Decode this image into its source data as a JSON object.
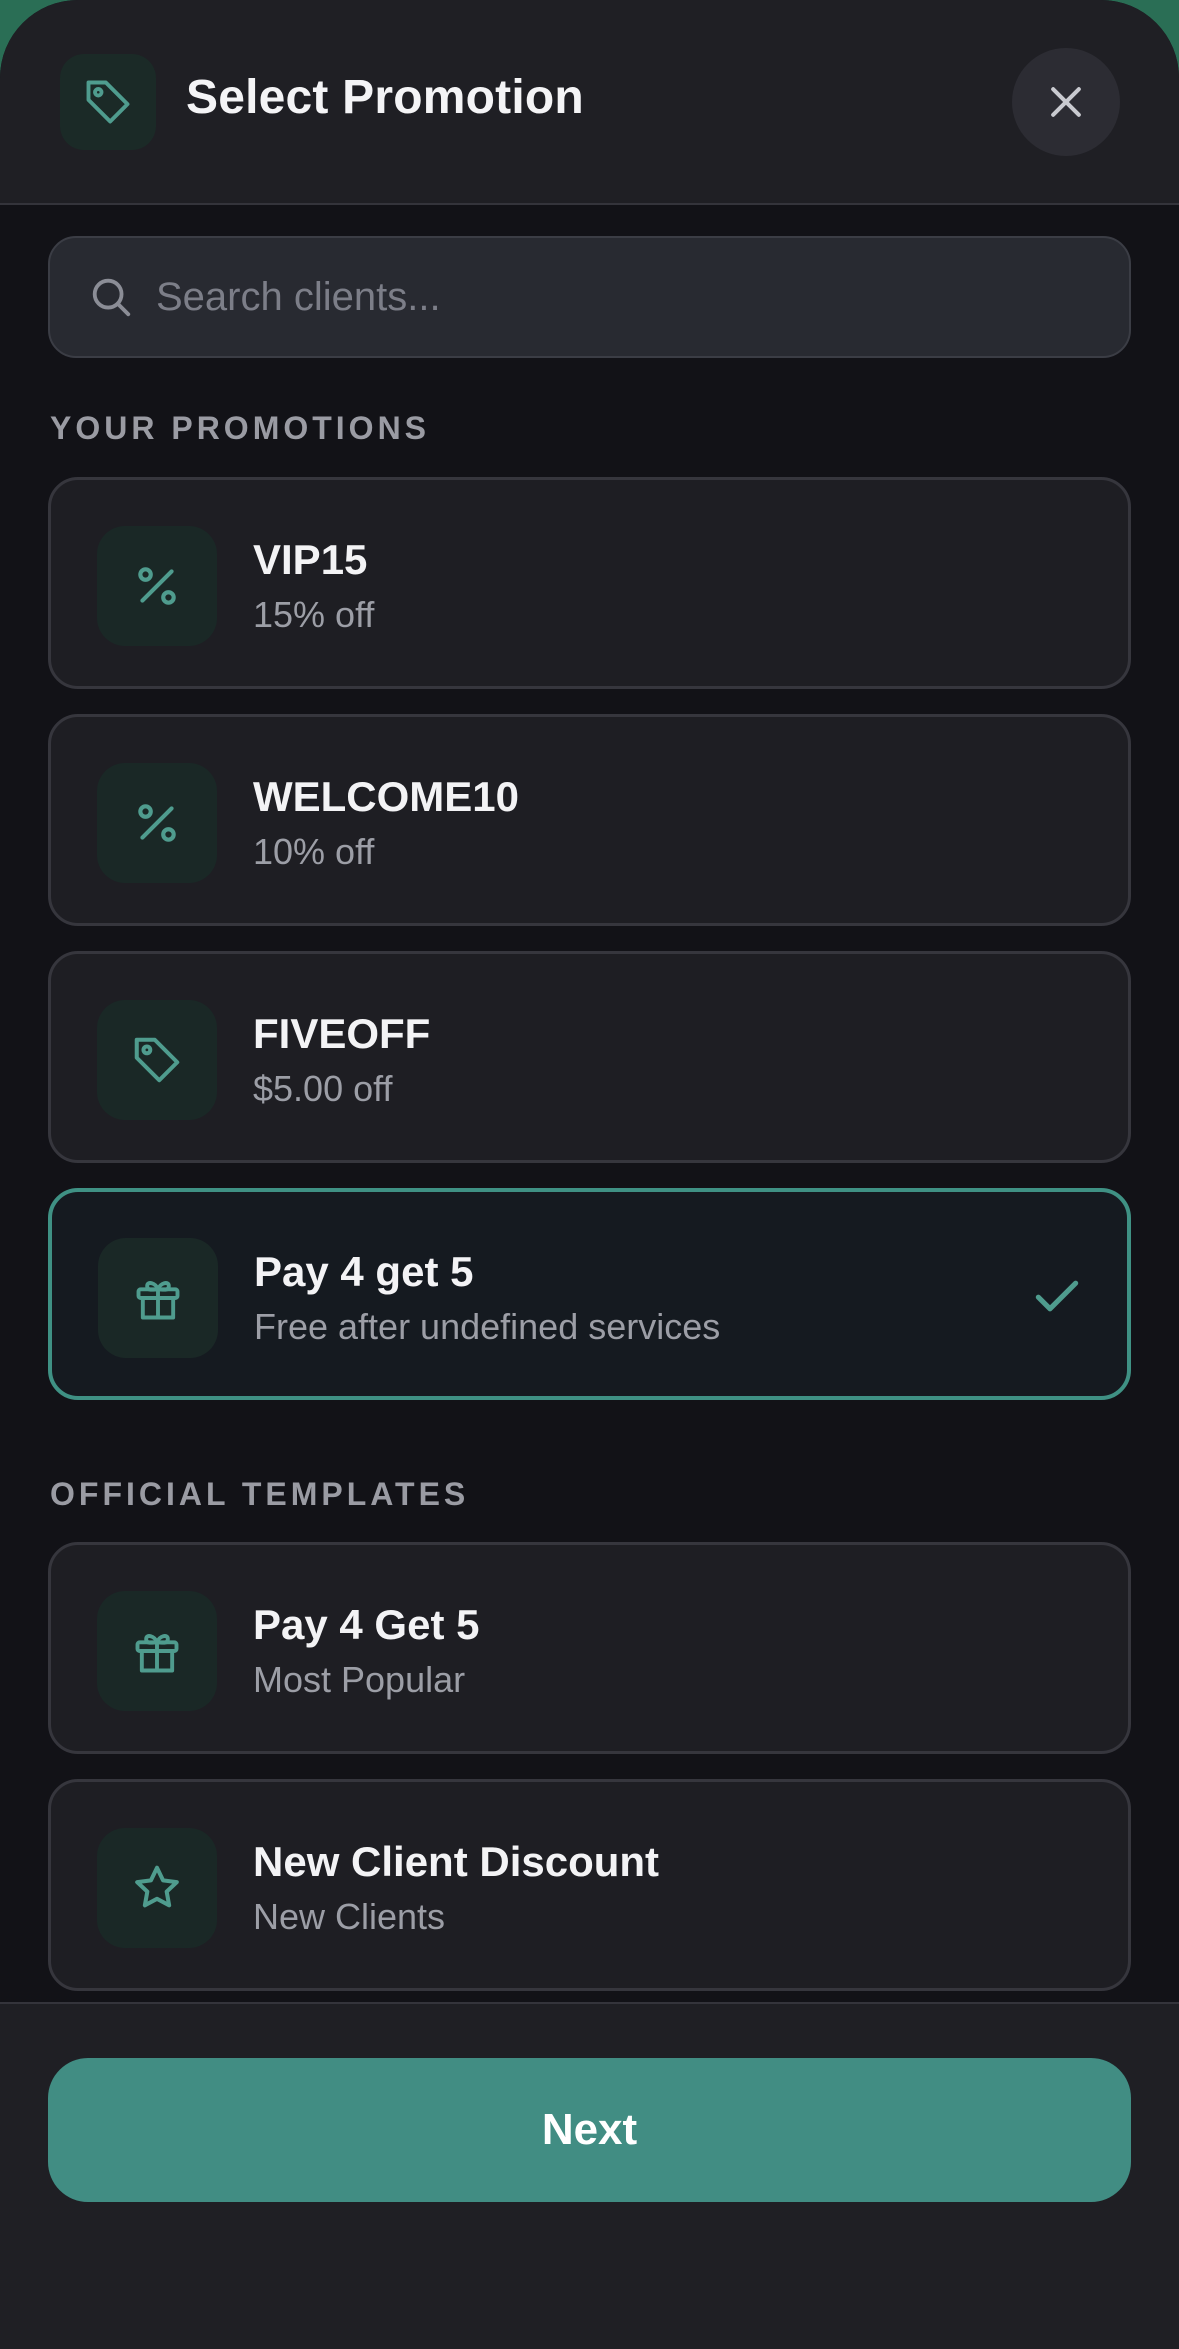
{
  "header": {
    "title": "Select Promotion",
    "icon": "tag-icon",
    "close_icon": "close-icon"
  },
  "search": {
    "placeholder": "Search clients...",
    "value": "",
    "icon": "search-icon"
  },
  "sections": {
    "your_promotions": {
      "label": "YOUR PROMOTIONS",
      "items": [
        {
          "title": "VIP15",
          "subtitle": "15% off",
          "icon": "percent-icon",
          "selected": false
        },
        {
          "title": "WELCOME10",
          "subtitle": "10% off",
          "icon": "percent-icon",
          "selected": false
        },
        {
          "title": "FIVEOFF",
          "subtitle": "$5.00 off",
          "icon": "tag-icon",
          "selected": false
        },
        {
          "title": "Pay 4 get 5",
          "subtitle": "Free after undefined services",
          "icon": "gift-icon",
          "selected": true
        }
      ]
    },
    "official_templates": {
      "label": "OFFICIAL TEMPLATES",
      "items": [
        {
          "title": "Pay 4 Get 5",
          "subtitle": "Most Popular",
          "icon": "gift-icon"
        },
        {
          "title": "New Client Discount",
          "subtitle": "New Clients",
          "icon": "star-icon"
        }
      ]
    }
  },
  "footer": {
    "next_label": "Next"
  },
  "colors": {
    "accent": "#418d83",
    "icon_teal": "#4f9c8e",
    "background": "#121217",
    "card": "#1e1e23"
  }
}
